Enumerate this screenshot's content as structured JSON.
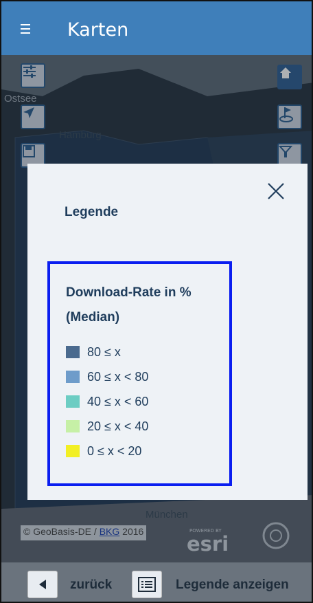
{
  "header": {
    "title": "Karten"
  },
  "map": {
    "labels": [
      "Ostsee",
      "Hamburg",
      "München"
    ],
    "attribution_prefix": "© GeoBasis-DE /",
    "attribution_link": "BKG",
    "attribution_year": "2016",
    "esri_powered": "POWERED BY",
    "esri": "esri"
  },
  "modal": {
    "title": "Legende",
    "legend_heading": "Download-Rate in % (Median)",
    "items": [
      {
        "label": "80 ≤ x",
        "color": "#4a6a8e"
      },
      {
        "label": "60 ≤ x < 80",
        "color": "#6e9cca"
      },
      {
        "label": "40 ≤ x < 60",
        "color": "#6ccdc3"
      },
      {
        "label": "20 ≤ x < 40",
        "color": "#c6f0a6"
      },
      {
        "label": "0 ≤ x < 20",
        "color": "#f2ef24"
      }
    ]
  },
  "bottom_bar": {
    "back_label": "zurück",
    "legend_label": "Legende anzeigen"
  },
  "colors": {
    "header": "#3f7fba",
    "modal_border": "#0a1ef0"
  }
}
